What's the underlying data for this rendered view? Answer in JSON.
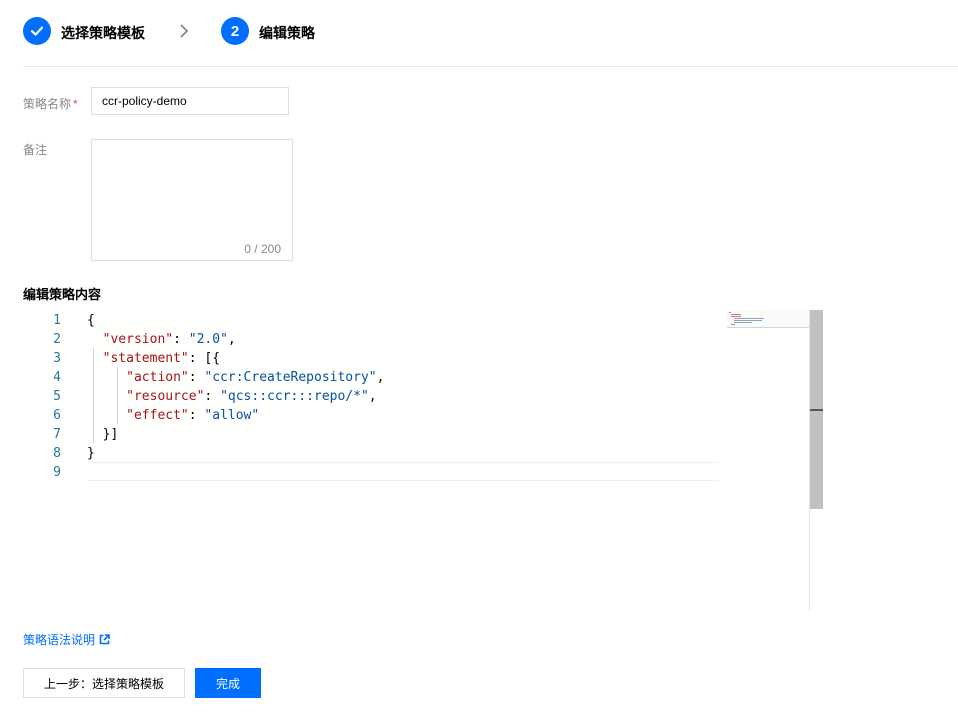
{
  "steps": [
    {
      "label": "选择策略模板",
      "status": "done",
      "icon": "check-icon"
    },
    {
      "number": "2",
      "label": "编辑策略",
      "status": "current"
    }
  ],
  "form": {
    "name_label": "策略名称",
    "required_mark": "*",
    "name_value": "ccr-policy-demo",
    "remark_label": "备注",
    "remark_value": "",
    "remark_counter": "0 / 200"
  },
  "editor": {
    "section_title": "编辑策略内容",
    "line_numbers": [
      "1",
      "2",
      "3",
      "4",
      "5",
      "6",
      "7",
      "8",
      "9"
    ],
    "lines": [
      [
        {
          "t": "{",
          "c": "p"
        }
      ],
      [
        {
          "t": "  ",
          "c": "p"
        },
        {
          "t": "\"version\"",
          "c": "k"
        },
        {
          "t": ": ",
          "c": "p"
        },
        {
          "t": "\"2.0\"",
          "c": "v"
        },
        {
          "t": ",",
          "c": "p"
        }
      ],
      [
        {
          "t": "  ",
          "c": "p"
        },
        {
          "t": "\"statement\"",
          "c": "k"
        },
        {
          "t": ": [{",
          "c": "p"
        }
      ],
      [
        {
          "t": "     ",
          "c": "p"
        },
        {
          "t": "\"action\"",
          "c": "k"
        },
        {
          "t": ": ",
          "c": "p"
        },
        {
          "t": "\"ccr:CreateRepository\"",
          "c": "v"
        },
        {
          "t": ",",
          "c": "p"
        }
      ],
      [
        {
          "t": "     ",
          "c": "p"
        },
        {
          "t": "\"resource\"",
          "c": "k"
        },
        {
          "t": ": ",
          "c": "p"
        },
        {
          "t": "\"qcs::ccr:::repo/*\"",
          "c": "v"
        },
        {
          "t": ",",
          "c": "p"
        }
      ],
      [
        {
          "t": "     ",
          "c": "p"
        },
        {
          "t": "\"effect\"",
          "c": "k"
        },
        {
          "t": ": ",
          "c": "p"
        },
        {
          "t": "\"allow\"",
          "c": "v"
        }
      ],
      [
        {
          "t": "  }]",
          "c": "p"
        }
      ],
      [
        {
          "t": "}",
          "c": "p"
        }
      ],
      [
        {
          "t": "",
          "c": "p"
        }
      ]
    ],
    "colors": {
      "key": "#a31515",
      "value": "#0451a5",
      "line_number": "#237893"
    }
  },
  "footer": {
    "doc_link": "策略语法说明",
    "doc_link_icon": "external-link-icon",
    "prev_button": "上一步：选择策略模板",
    "done_button": "完成"
  },
  "colors": {
    "accent": "#006eff",
    "required": "#e54545"
  }
}
